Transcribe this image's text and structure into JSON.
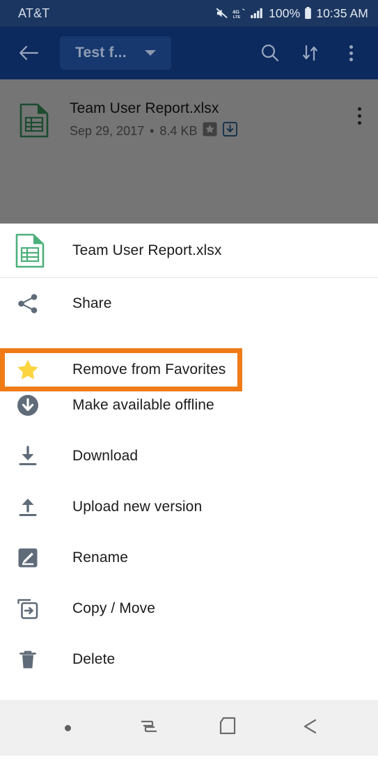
{
  "status_bar": {
    "carrier": "AT&T",
    "network": "4G LTE",
    "battery_percent": "100%",
    "time": "10:35 AM",
    "icons": [
      "mute-icon",
      "lte-icon",
      "signal-icon",
      "battery-icon"
    ],
    "background_color": "#1b3660"
  },
  "toolbar": {
    "back_icon": "back-arrow-icon",
    "title": "Test f...",
    "dropdown_icon": "chevron-down-icon",
    "search_icon": "search-icon",
    "sort_icon": "sort-icon",
    "overflow_icon": "overflow-menu-icon",
    "background_color": "#0d2a5e"
  },
  "file_list": {
    "rows": [
      {
        "name": "Team User Report.xlsx",
        "date": "Sep 29, 2017",
        "separator": "•",
        "size": "8.4 KB",
        "badges": [
          "favorite-badge",
          "offline-badge"
        ],
        "icon": "spreadsheet-file-icon",
        "overflow_icon": "overflow-menu-icon"
      }
    ]
  },
  "bottom_sheet": {
    "header": {
      "icon": "spreadsheet-file-icon",
      "title": "Team User Report.xlsx"
    },
    "items": [
      {
        "label": "Share",
        "icon": "share-icon",
        "highlighted": false
      },
      {
        "label": "Remove from Favorites",
        "icon": "star-icon",
        "highlighted": true
      },
      {
        "label": "Make available offline",
        "icon": "offline-circle-download-icon",
        "highlighted": false
      },
      {
        "label": "Download",
        "icon": "download-icon",
        "highlighted": false
      },
      {
        "label": "Upload new version",
        "icon": "upload-icon",
        "highlighted": false
      },
      {
        "label": "Rename",
        "icon": "pencil-edit-icon",
        "highlighted": false
      },
      {
        "label": "Copy / Move",
        "icon": "copy-move-icon",
        "highlighted": false
      },
      {
        "label": "Delete",
        "icon": "trash-icon",
        "highlighted": false
      }
    ],
    "highlight_color": "#f07c18",
    "star_color": "#fbd440"
  },
  "nav_bar": {
    "items": [
      "dot-indicator",
      "recents-icon",
      "home-icon",
      "back-icon"
    ],
    "background_color": "#f0f0f0"
  }
}
